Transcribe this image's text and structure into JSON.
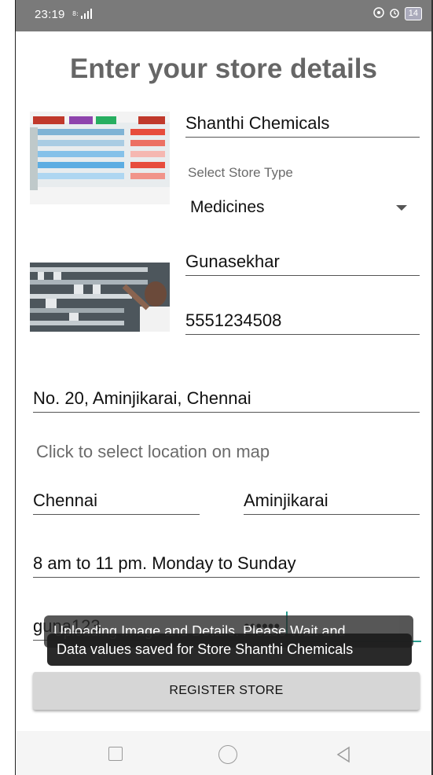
{
  "status_bar": {
    "time": "23:19",
    "battery": "14"
  },
  "title": "Enter your store details",
  "store": {
    "name": "Shanthi Chemicals",
    "type_label": "Select Store Type",
    "type_value": "Medicines"
  },
  "owner": {
    "name": "Gunasekhar",
    "phone": "5551234508"
  },
  "address": "No. 20, Aminjikarai, Chennai",
  "map_link": "Click to select location on map",
  "city": "Chennai",
  "area": "Aminjikarai",
  "hours": "8 am to 11 pm. Monday to Sunday",
  "username": "guna123",
  "password_mask": "••••••",
  "toasts": {
    "back": "Uploading Image and Details. Please Wait and",
    "front": "Data values saved for Store Shanthi Chemicals"
  },
  "register_button": "REGISTER STORE"
}
